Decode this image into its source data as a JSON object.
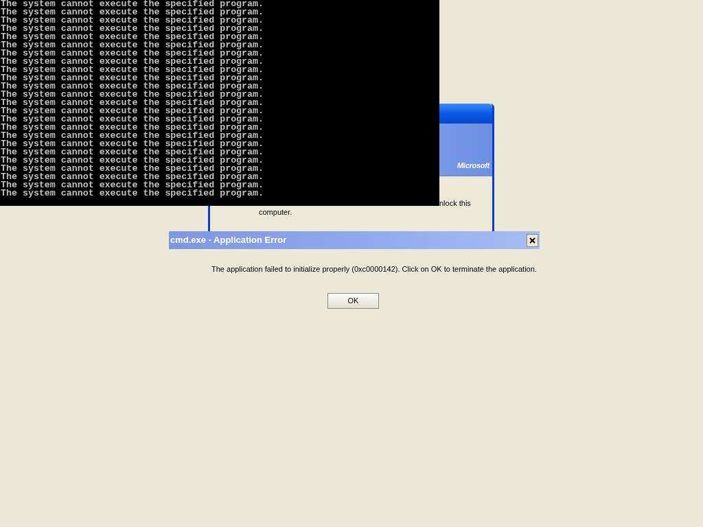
{
  "console": {
    "lines": [
      "The system cannot execute the specified program.",
      "The system cannot execute the specified program.",
      "The system cannot execute the specified program.",
      "The system cannot execute the specified program.",
      "The system cannot execute the specified program.",
      "The system cannot execute the specified program.",
      "The system cannot execute the specified program.",
      "The system cannot execute the specified program.",
      "The system cannot execute the specified program.",
      "The system cannot execute the specified program.",
      "The system cannot execute the specified program.",
      "The system cannot execute the specified program.",
      "The system cannot execute the specified program.",
      "The system cannot execute the specified program.",
      "The system cannot execute the specified program.",
      "The system cannot execute the specified program.",
      "The system cannot execute the specified program.",
      "The system cannot execute the specified program.",
      "The system cannot execute the specified program.",
      "The system cannot execute the specified program.",
      "The system cannot execute the specified program.",
      "The system cannot execute the specified program.",
      "The system cannot execute the specified program.",
      "The system cannot execute the specified program."
    ]
  },
  "lock_dialog": {
    "logo": "Microsoft",
    "message_fragment": "nlock this",
    "message_line_2": "computer."
  },
  "error_dialog": {
    "title": "cmd.exe - Application Error",
    "message": "The application failed to initialize properly (0xc0000142). Click on OK to terminate the application.",
    "buttons": [
      "OK"
    ]
  }
}
